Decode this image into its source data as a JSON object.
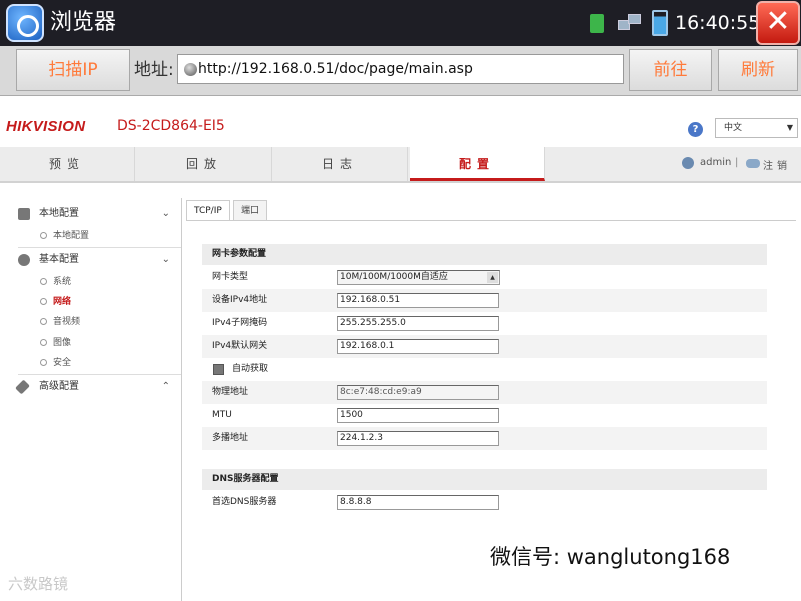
{
  "titlebar": {
    "app_title": "浏览器",
    "clock": "16:40:55",
    "icons": [
      "sd-card-icon",
      "network-icon",
      "battery-icon",
      "close-icon"
    ]
  },
  "addressbar": {
    "scan_label": "扫描IP",
    "address_label": "地址:",
    "url": "http://192.168.0.51/doc/page/main.asp",
    "forward_label": "前往",
    "refresh_label": "刷新"
  },
  "header": {
    "logo": "HIKVISION",
    "model": "DS-2CD864-EI5",
    "language": "中文",
    "user": "admin",
    "separator": "|",
    "logout": "注销"
  },
  "nav": {
    "tabs": [
      "预览",
      "回放",
      "日志",
      "配置"
    ],
    "active": "配置"
  },
  "sidebar": {
    "local_config": "本地配置",
    "local_config_item": "本地配置",
    "basic_config": "基本配置",
    "basic_items": [
      "系统",
      "网络",
      "音视频",
      "图像",
      "安全"
    ],
    "active_item": "网络",
    "advanced_config": "高级配置"
  },
  "content": {
    "tabs": [
      "TCP/IP",
      "端口"
    ],
    "nic_section": "网卡参数配置",
    "fields": {
      "nic_type_label": "网卡类型",
      "nic_type_value": "10M/100M/1000M自适应",
      "ipv4_addr_label": "设备IPv4地址",
      "ipv4_addr_value": "192.168.0.51",
      "ipv4_mask_label": "IPv4子网掩码",
      "ipv4_mask_value": "255.255.255.0",
      "ipv4_gw_label": "IPv4默认网关",
      "ipv4_gw_value": "192.168.0.1",
      "auto_label": "自动获取",
      "mac_label": "物理地址",
      "mac_value": "8c:e7:48:cd:e9:a9",
      "mtu_label": "MTU",
      "mtu_value": "1500",
      "multicast_label": "多播地址",
      "multicast_value": "224.1.2.3"
    },
    "dns_section": "DNS服务器配置",
    "dns_label": "首选DNS服务器",
    "dns_value": "8.8.8.8"
  },
  "watermarks": {
    "right": "微信号: wanglutong168",
    "left": "六数路镜"
  },
  "colors": {
    "brand": "#c51b1b",
    "titlebar": "#1e1e25",
    "button_text": "#ff7a3a"
  }
}
